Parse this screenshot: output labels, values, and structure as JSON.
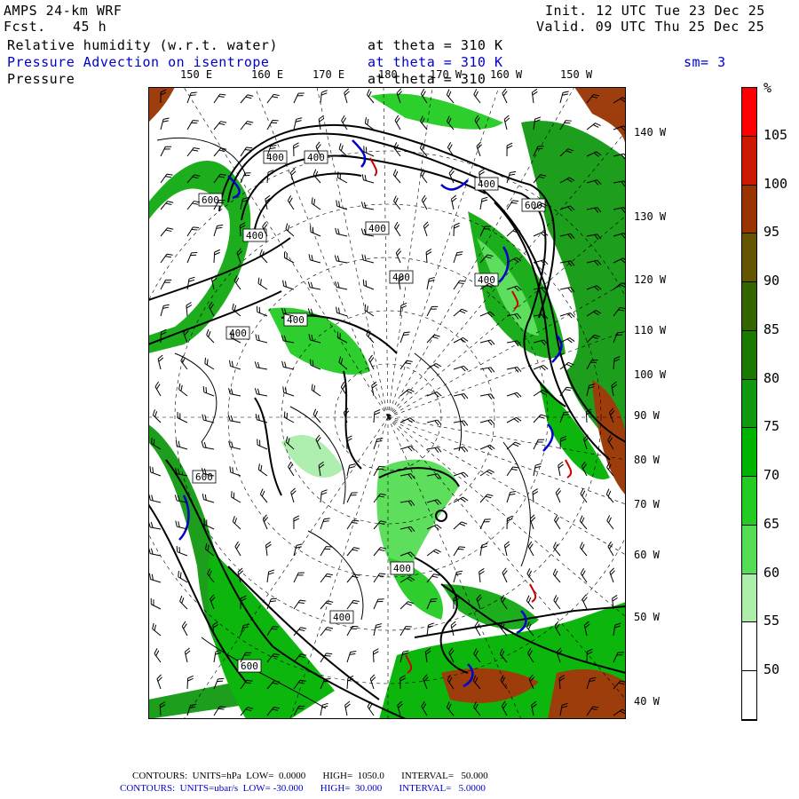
{
  "header": {
    "model": "AMPS 24-km WRF",
    "fcst_label": "Fcst.",
    "fcst_value": "45 h",
    "init": "Init. 12 UTC Tue 23 Dec 25",
    "valid": "Valid. 09 UTC Thu 25 Dec 25"
  },
  "fields": {
    "rh_label": "Relative humidity (w.r.t. water)",
    "rh_level": "at theta = 310 K",
    "adv_label": "Pressure Advection on isentrope",
    "adv_level": "at theta = 310 K",
    "smoothing": "sm= 3",
    "pres_label": "Pressure",
    "pres_level": "at theta = 310"
  },
  "longitudes_top": [
    "150 E",
    "160 E",
    "170 E",
    "180",
    "170 W",
    "160 W",
    "150 W"
  ],
  "longitudes_right": [
    "140 W",
    "130 W",
    "120 W",
    "110 W",
    "100 W",
    "90 W",
    "80 W",
    "70 W",
    "60 W",
    "50 W",
    "40 W"
  ],
  "contour_labels": [
    "400",
    "400",
    "600",
    "400",
    "400",
    "400",
    "400",
    "400",
    "400",
    "400",
    "600",
    "600",
    "400",
    "400",
    "400",
    "600",
    "400"
  ],
  "legend": {
    "unit": "%",
    "levels": [
      "105",
      "100",
      "95",
      "90",
      "85",
      "80",
      "75",
      "70",
      "65",
      "60",
      "55",
      "50"
    ],
    "colors": [
      "#ff0000",
      "#cc1a00",
      "#993300",
      "#665500",
      "#336600",
      "#1a7a00",
      "#119911",
      "#00b300",
      "#22cc22",
      "#55dd55",
      "#aaeeaa",
      "#ffffff",
      "#ffffff"
    ]
  },
  "footer": {
    "line1": "CONTOURS:  UNITS=hPa  LOW=  0.0000       HIGH=  1050.0       INTERVAL=   50.000",
    "line2": "CONTOURS:  UNITS=ubar/s  LOW= -30.000       HIGH=  30.000       INTERVAL=   5.0000"
  },
  "colors": {
    "advection": "#0000cc",
    "frame": "#000000"
  }
}
